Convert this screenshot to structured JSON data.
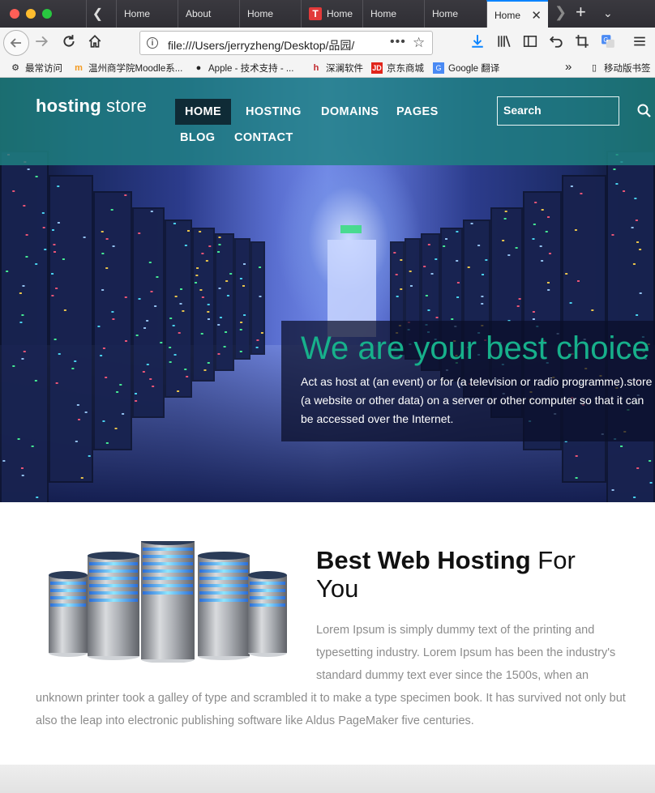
{
  "browser": {
    "tabs": [
      {
        "label": "Home"
      },
      {
        "label": "About"
      },
      {
        "label": "Home"
      },
      {
        "label": "Home",
        "icon_letter": "T"
      },
      {
        "label": "Home"
      },
      {
        "label": "Home"
      },
      {
        "label": "Home",
        "active": true
      }
    ],
    "url": "file:///Users/jerryzheng/Desktop/品园/",
    "more_label": "•••",
    "bookmarks": [
      {
        "label": "最常访问",
        "icon": "gear-icon"
      },
      {
        "label": "温州商学院Moodle系...",
        "icon": "moodle-icon"
      },
      {
        "label": "Apple - 技术支持 - ...",
        "icon": "apple-icon"
      },
      {
        "label": "深澜软件",
        "icon": "srun-icon"
      },
      {
        "label": "京东商城",
        "icon": "jd-icon"
      },
      {
        "label": "Google 翻译",
        "icon": "google-translate-icon"
      },
      {
        "label": "移动版书签",
        "icon": "mobile-icon"
      }
    ],
    "overflow_label": "»"
  },
  "site": {
    "logo_bold": "hosting",
    "logo_rest": " store",
    "menu": [
      {
        "label": "HOME",
        "active": true
      },
      {
        "label": "HOSTING"
      },
      {
        "label": "DOMAINS"
      },
      {
        "label": "PAGES"
      },
      {
        "label": "BLOG"
      },
      {
        "label": "CONTACT"
      }
    ],
    "search_placeholder": "Search"
  },
  "hero": {
    "title": "We are your best choice",
    "text": "Act as host at (an event) or for (a television or radio programme).store (a website or other data) on a server or other computer so that it can be accessed over the Internet."
  },
  "about": {
    "heading_bold": "Best Web Hosting",
    "heading_rest": " For You",
    "para_part1": "Lorem Ipsum is simply dummy text of the printing and typesetting industry. Lorem Ipsum has been the industry's standard dummy text ever since the 1500s, when an",
    "para_part2": "unknown printer took a galley of type and scrambled it to make a type specimen book. It has survived not only but also the leap into electronic publishing software like Aldus PageMaker five centuries."
  },
  "colors": {
    "header_overlay": "#1e8282",
    "accent_green": "#17b08b",
    "menu_active_bg": "#0f2b36",
    "body_text": "#8c8c8c"
  }
}
